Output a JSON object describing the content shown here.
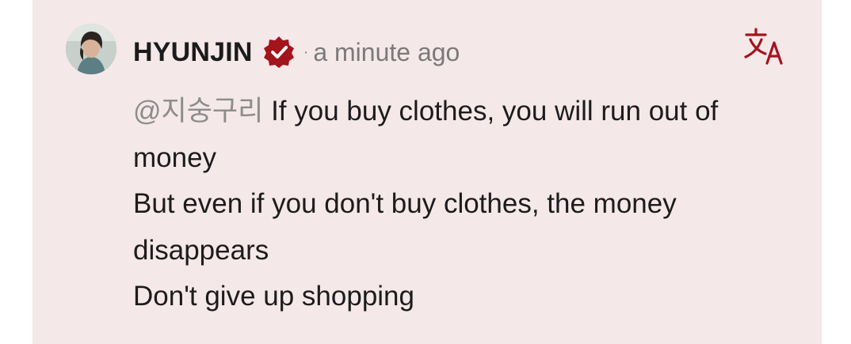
{
  "comment": {
    "author": "HYUNJIN",
    "separator": "·",
    "timestamp": "a minute ago",
    "mention": "@지숭구리",
    "lines": [
      "If you buy clothes, you will run out of money",
      "But even if you don't buy clothes, the money disappears",
      "Don't give up shopping"
    ]
  },
  "icons": {
    "avatar": "avatar-photo",
    "verified": "verified-badge-icon",
    "translate": "translate-icon"
  },
  "colors": {
    "card_background": "#f5e8e9",
    "accent": "#a3141c",
    "text": "#1c1c1c",
    "muted": "#7a7a7a"
  }
}
